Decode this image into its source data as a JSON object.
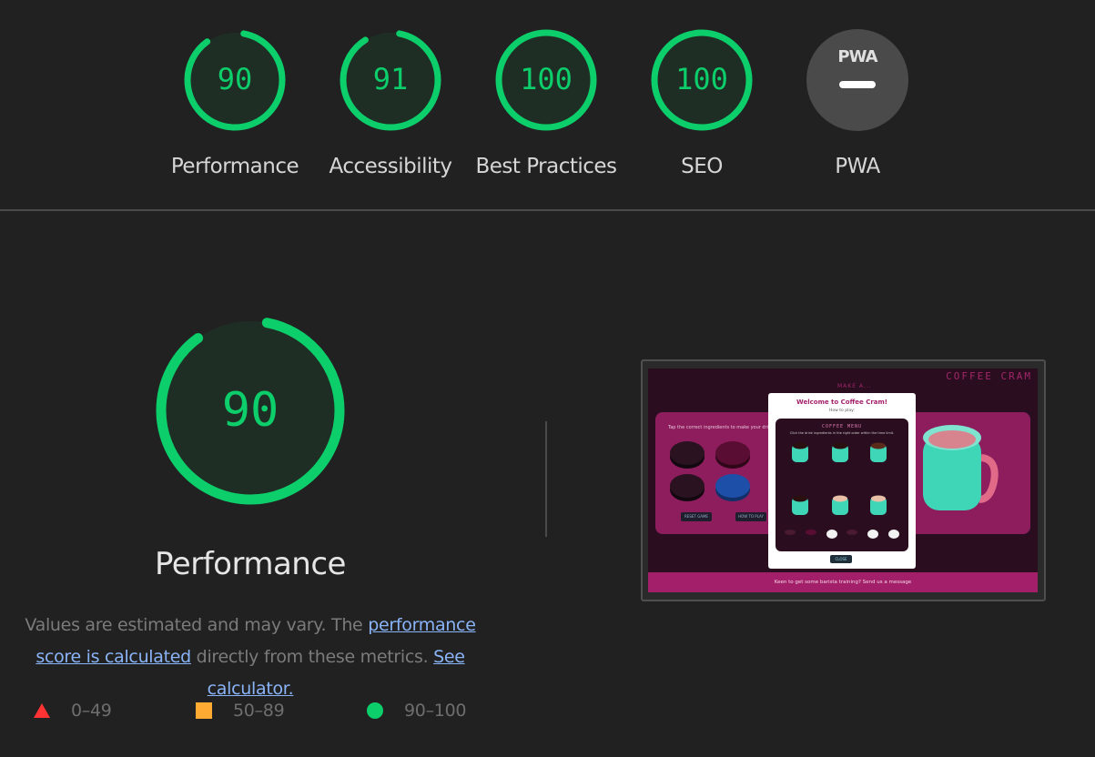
{
  "gauges": [
    {
      "id": "performance",
      "score": "90",
      "label": "Performance",
      "fraction": 0.9
    },
    {
      "id": "accessibility",
      "score": "91",
      "label": "Accessibility",
      "fraction": 0.91
    },
    {
      "id": "best-practices",
      "score": "100",
      "label": "Best Practices",
      "fraction": 1.0
    },
    {
      "id": "seo",
      "score": "100",
      "label": "SEO",
      "fraction": 1.0
    },
    {
      "id": "pwa",
      "score": "",
      "badge": "PWA",
      "label": "PWA"
    }
  ],
  "performance": {
    "score": "90",
    "fraction": 0.9,
    "title": "Performance",
    "desc_before": "Values are estimated and may vary. The ",
    "desc_link1": "performance score is calculated",
    "desc_middle": " directly from these metrics. ",
    "desc_link2": "See calculator."
  },
  "legend": [
    {
      "shape": "triangle",
      "color": "#ff3333",
      "range": "0–49"
    },
    {
      "shape": "square",
      "color": "#ffaa33",
      "range": "50–89"
    },
    {
      "shape": "circle",
      "color": "#0cce6b",
      "range": "90–100"
    }
  ],
  "screenshot": {
    "app_title": "COFFEE CRAM",
    "make_label": "MAKE A...",
    "instructions": "Tap the correct ingredients to make your drink",
    "reset_label": "RESET GAME",
    "how_label": "HOW TO PLAY",
    "modal_title": "Welcome to Coffee Cram!",
    "modal_subtitle": "How to play:",
    "menu_title": "COFFEE MENU",
    "menu_subtitle": "Click the drink ingredients in the right order within the time limit.",
    "close_label": "CLOSE",
    "footer_text": "Keen to get some barista training? Send us a message"
  },
  "colors": {
    "pass": "#0cce6b",
    "pass_bg": "#1f2e24",
    "pwa_bg": "#4a4a4a",
    "link": "#8ab4f8"
  }
}
